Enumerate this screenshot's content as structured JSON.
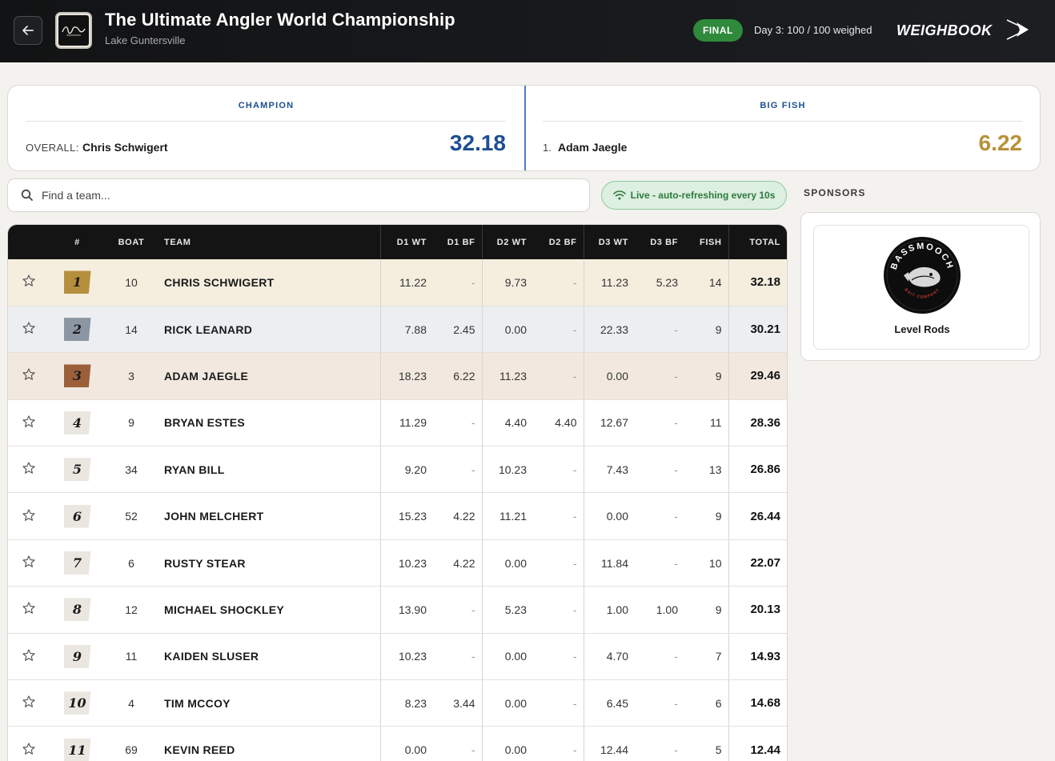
{
  "header": {
    "title": "The Ultimate Angler World Championship",
    "subtitle": "Lake Guntersville",
    "status_badge": "FINAL",
    "day_status": "Day 3: 100 / 100 weighed",
    "brand": "WEIGHBOOK",
    "status_color": "#2f8a3c"
  },
  "summary": {
    "champion": {
      "label": "CHAMPION",
      "row_label": "OVERALL:",
      "name": "Chris Schwigert",
      "value": "32.18",
      "color": "#1d4f91"
    },
    "big_fish": {
      "label": "BIG FISH",
      "rank": "1.",
      "name": "Adam Jaegle",
      "value": "6.22",
      "color": "#b8913a"
    }
  },
  "search": {
    "placeholder": "Find a team..."
  },
  "live": {
    "label": "Live - auto-refreshing every 10s"
  },
  "sponsors": {
    "title": "SPONSORS",
    "items": [
      {
        "name": "Level Rods",
        "logo_text": "BASSMOOCH",
        "logo_subtext": "BAIT COMPANY"
      }
    ]
  },
  "table": {
    "columns": [
      "#",
      "BOAT",
      "TEAM",
      "D1 WT",
      "D1 BF",
      "D2 WT",
      "D2 BF",
      "D3 WT",
      "D3 BF",
      "FISH",
      "TOTAL"
    ],
    "rows": [
      {
        "rank": "1",
        "boat": "10",
        "team": "CHRIS SCHWIGERT",
        "d1wt": "11.22",
        "d1bf": "-",
        "d2wt": "9.73",
        "d2bf": "-",
        "d3wt": "11.23",
        "d3bf": "5.23",
        "fish": "14",
        "total": "32.18"
      },
      {
        "rank": "2",
        "boat": "14",
        "team": "RICK LEANARD",
        "d1wt": "7.88",
        "d1bf": "2.45",
        "d2wt": "0.00",
        "d2bf": "-",
        "d3wt": "22.33",
        "d3bf": "-",
        "fish": "9",
        "total": "30.21"
      },
      {
        "rank": "3",
        "boat": "3",
        "team": "ADAM JAEGLE",
        "d1wt": "18.23",
        "d1bf": "6.22",
        "d2wt": "11.23",
        "d2bf": "-",
        "d3wt": "0.00",
        "d3bf": "-",
        "fish": "9",
        "total": "29.46"
      },
      {
        "rank": "4",
        "boat": "9",
        "team": "BRYAN ESTES",
        "d1wt": "11.29",
        "d1bf": "-",
        "d2wt": "4.40",
        "d2bf": "4.40",
        "d3wt": "12.67",
        "d3bf": "-",
        "fish": "11",
        "total": "28.36"
      },
      {
        "rank": "5",
        "boat": "34",
        "team": "RYAN BILL",
        "d1wt": "9.20",
        "d1bf": "-",
        "d2wt": "10.23",
        "d2bf": "-",
        "d3wt": "7.43",
        "d3bf": "-",
        "fish": "13",
        "total": "26.86"
      },
      {
        "rank": "6",
        "boat": "52",
        "team": "JOHN MELCHERT",
        "d1wt": "15.23",
        "d1bf": "4.22",
        "d2wt": "11.21",
        "d2bf": "-",
        "d3wt": "0.00",
        "d3bf": "-",
        "fish": "9",
        "total": "26.44"
      },
      {
        "rank": "7",
        "boat": "6",
        "team": "RUSTY STEAR",
        "d1wt": "10.23",
        "d1bf": "4.22",
        "d2wt": "0.00",
        "d2bf": "-",
        "d3wt": "11.84",
        "d3bf": "-",
        "fish": "10",
        "total": "22.07"
      },
      {
        "rank": "8",
        "boat": "12",
        "team": "MICHAEL SHOCKLEY",
        "d1wt": "13.90",
        "d1bf": "-",
        "d2wt": "5.23",
        "d2bf": "-",
        "d3wt": "1.00",
        "d3bf": "1.00",
        "fish": "9",
        "total": "20.13"
      },
      {
        "rank": "9",
        "boat": "11",
        "team": "KAIDEN SLUSER",
        "d1wt": "10.23",
        "d1bf": "-",
        "d2wt": "0.00",
        "d2bf": "-",
        "d3wt": "4.70",
        "d3bf": "-",
        "fish": "7",
        "total": "14.93"
      },
      {
        "rank": "10",
        "boat": "4",
        "team": "TIM MCCOY",
        "d1wt": "8.23",
        "d1bf": "3.44",
        "d2wt": "0.00",
        "d2bf": "-",
        "d3wt": "6.45",
        "d3bf": "-",
        "fish": "6",
        "total": "14.68"
      },
      {
        "rank": "11",
        "boat": "69",
        "team": "KEVIN REED",
        "d1wt": "0.00",
        "d1bf": "-",
        "d2wt": "0.00",
        "d2bf": "-",
        "d3wt": "12.44",
        "d3bf": "-",
        "fish": "5",
        "total": "12.44"
      }
    ]
  },
  "icons": {
    "back": "arrow-left-icon",
    "search": "search-icon",
    "live": "wifi-icon",
    "favorite": "star-outline-icon"
  }
}
